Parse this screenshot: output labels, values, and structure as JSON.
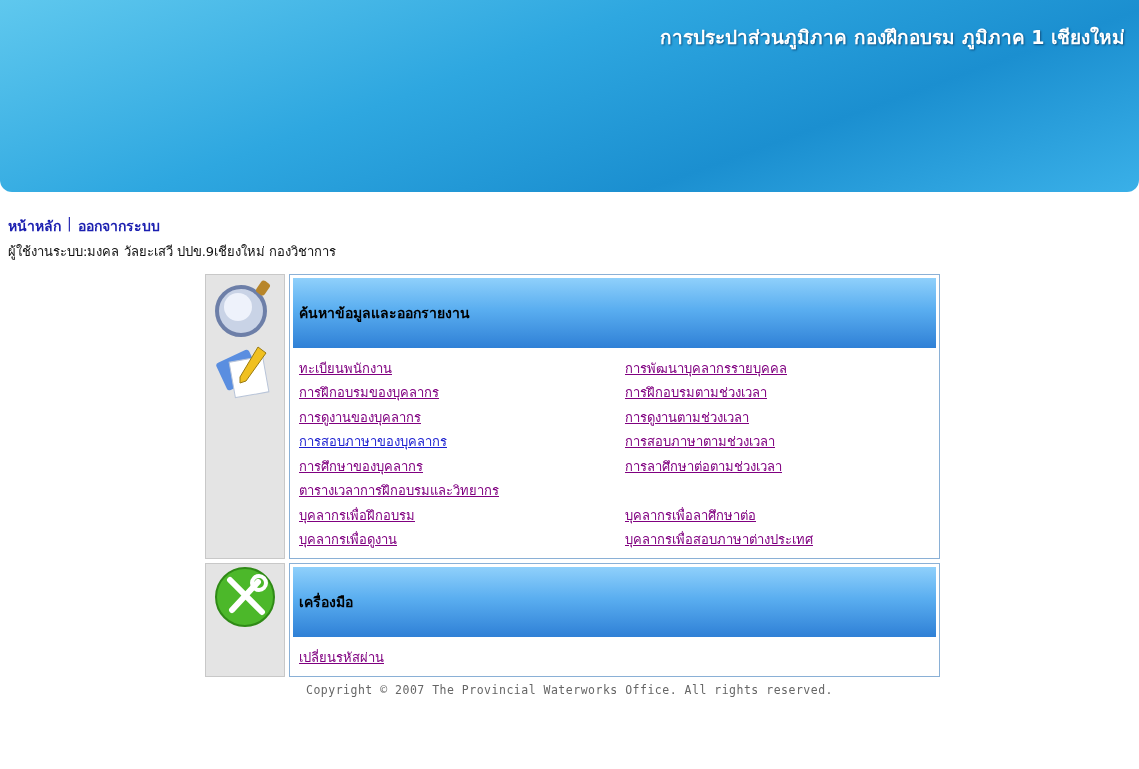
{
  "banner": {
    "title": "การประปาส่วนภูมิภาค กองฝึกอบรม ภูมิภาค 1 เชียงใหม่"
  },
  "nav": [
    {
      "label": "หน้าหลัก"
    },
    {
      "label": "ออกจากระบบ"
    }
  ],
  "nav_separator": "|",
  "user_line": "ผู้ใช้งานระบบ:มงคล วัลยะเสวี ปปข.9เชียงใหม่   กองวิชาการ",
  "sections": [
    {
      "kind": "search",
      "title": "ค้นหาข้อมูลและออกรายงาน",
      "rows": [
        [
          {
            "text": "ทะเบียนพนักงาน",
            "visited": true
          },
          {
            "text": "การพัฒนาบุคลากรรายบุคคล",
            "visited": true
          }
        ],
        [
          {
            "text": "การฝึกอบรมของบุคลากร",
            "visited": true
          },
          {
            "text": "การฝึกอบรมตามช่วงเวลา",
            "visited": true
          }
        ],
        [
          {
            "text": "การดูงานของบุคลากร",
            "visited": true
          },
          {
            "text": "การดูงานตามช่วงเวลา",
            "visited": true
          }
        ],
        [
          {
            "text": "การสอบภาษาของบุคลากร",
            "visited": false
          },
          {
            "text": "การสอบภาษาตามช่วงเวลา",
            "visited": true
          }
        ],
        [
          {
            "text": "การศึกษาของบุคลากร",
            "visited": true
          },
          {
            "text": "การลาศึกษาต่อตามช่วงเวลา",
            "visited": true
          }
        ],
        [
          {
            "text": "ตารางเวลาการฝึกอบรมและวิทยากร",
            "visited": true
          }
        ],
        [
          {
            "text": "บุคลากรเพื่อฝึกอบรม",
            "visited": true
          },
          {
            "text": "บุคลากรเพื่อลาศึกษาต่อ",
            "visited": true
          }
        ],
        [
          {
            "text": "บุคลากรเพื่อดูงาน",
            "visited": true
          },
          {
            "text": "บุคลากรเพื่อสอบภาษาต่างประเทศ",
            "visited": true
          }
        ]
      ]
    },
    {
      "kind": "tools",
      "title": "เครื่องมือ",
      "rows": [
        [
          {
            "text": "เปลี่ยนรหัสผ่าน",
            "visited": true
          }
        ]
      ]
    }
  ],
  "footer": "Copyright © 2007 The Provincial Waterworks Office. All rights reserved."
}
